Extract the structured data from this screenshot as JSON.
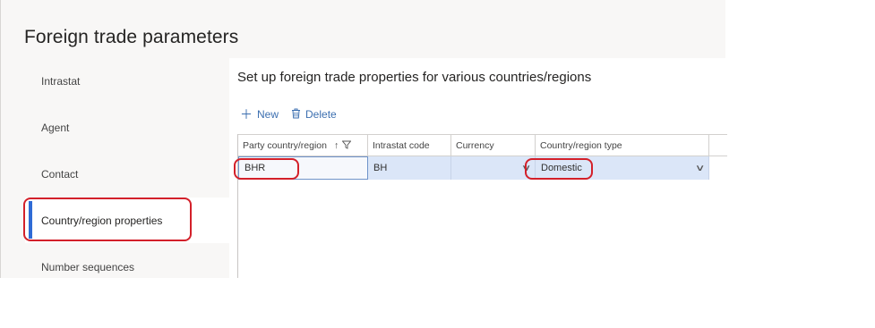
{
  "page": {
    "title": "Foreign trade parameters"
  },
  "sidebar": {
    "items": [
      {
        "label": "Intrastat"
      },
      {
        "label": "Agent"
      },
      {
        "label": "Contact"
      },
      {
        "label": "Country/region properties",
        "active": true
      },
      {
        "label": "Number sequences"
      }
    ]
  },
  "main": {
    "section_title": "Set up foreign trade properties for various countries/regions",
    "toolbar": {
      "new_label": "New",
      "delete_label": "Delete"
    },
    "grid": {
      "columns": [
        "Party country/region",
        "Intrastat code",
        "Currency",
        "Country/region type"
      ],
      "sort_indicator": "↑",
      "rows": [
        {
          "party_country_region": "BHR",
          "intrastat_code": "BH",
          "currency": "",
          "country_region_type": "Domestic"
        }
      ]
    }
  },
  "colors": {
    "accent": "#2f6bd6",
    "link": "#3c6fb0",
    "annotation": "#d3202a",
    "row_selected": "#dbe6f8"
  }
}
